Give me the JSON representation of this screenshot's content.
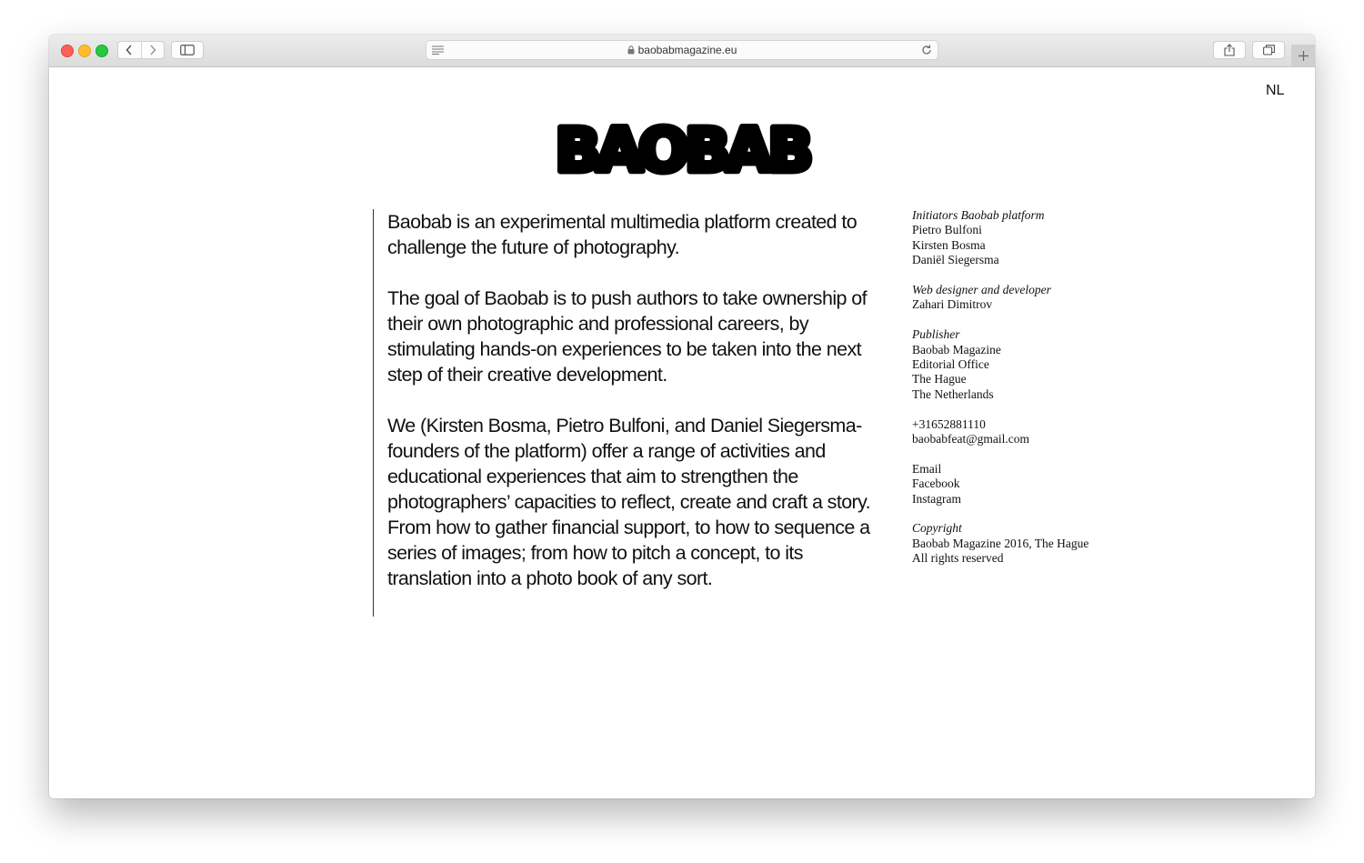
{
  "browser": {
    "url": "baobabmagazine.eu"
  },
  "header": {
    "lang_switch": "NL",
    "logo_text": "BAOBAB"
  },
  "intro": {
    "paragraphs": [
      "Baobab is an experimental multimedia platform created to challenge the future of photography.",
      "The goal of Baobab is to push authors to take ownership of their own photographic and professional careers, by stimulating hands-on experiences to be taken into the next step of their creative development.",
      "We (Kirsten Bosma, Pietro Bulfoni, and Daniel Siegersma- founders of the platform) offer a range of activities and educational experiences that aim to strengthen the photographers’ capacities to reflect, create and craft a story. From how to gather financial support, to how to sequence a series of images; from how to pitch a concept, to its translation into a photo book of any sort."
    ]
  },
  "credits": {
    "initiators": {
      "label": "Initiators Baobab platform",
      "names": [
        "Pietro Bulfoni",
        "Kirsten Bosma",
        "Daniël Siegersma"
      ]
    },
    "web": {
      "label": "Web designer and developer",
      "names": [
        "Zahari Dimitrov"
      ]
    },
    "publisher": {
      "label": "Publisher",
      "lines": [
        "Baobab Magazine",
        "Editorial Office",
        "The Hague",
        "The Netherlands"
      ]
    },
    "contact": {
      "phone": "+31652881110",
      "email": "baobabfeat@gmail.com"
    },
    "links": {
      "email": "Email",
      "facebook": "Facebook",
      "instagram": "Instagram"
    },
    "copyright": {
      "label": "Copyright",
      "lines": [
        "Baobab Magazine 2016, The Hague",
        "All rights reserved"
      ]
    }
  }
}
